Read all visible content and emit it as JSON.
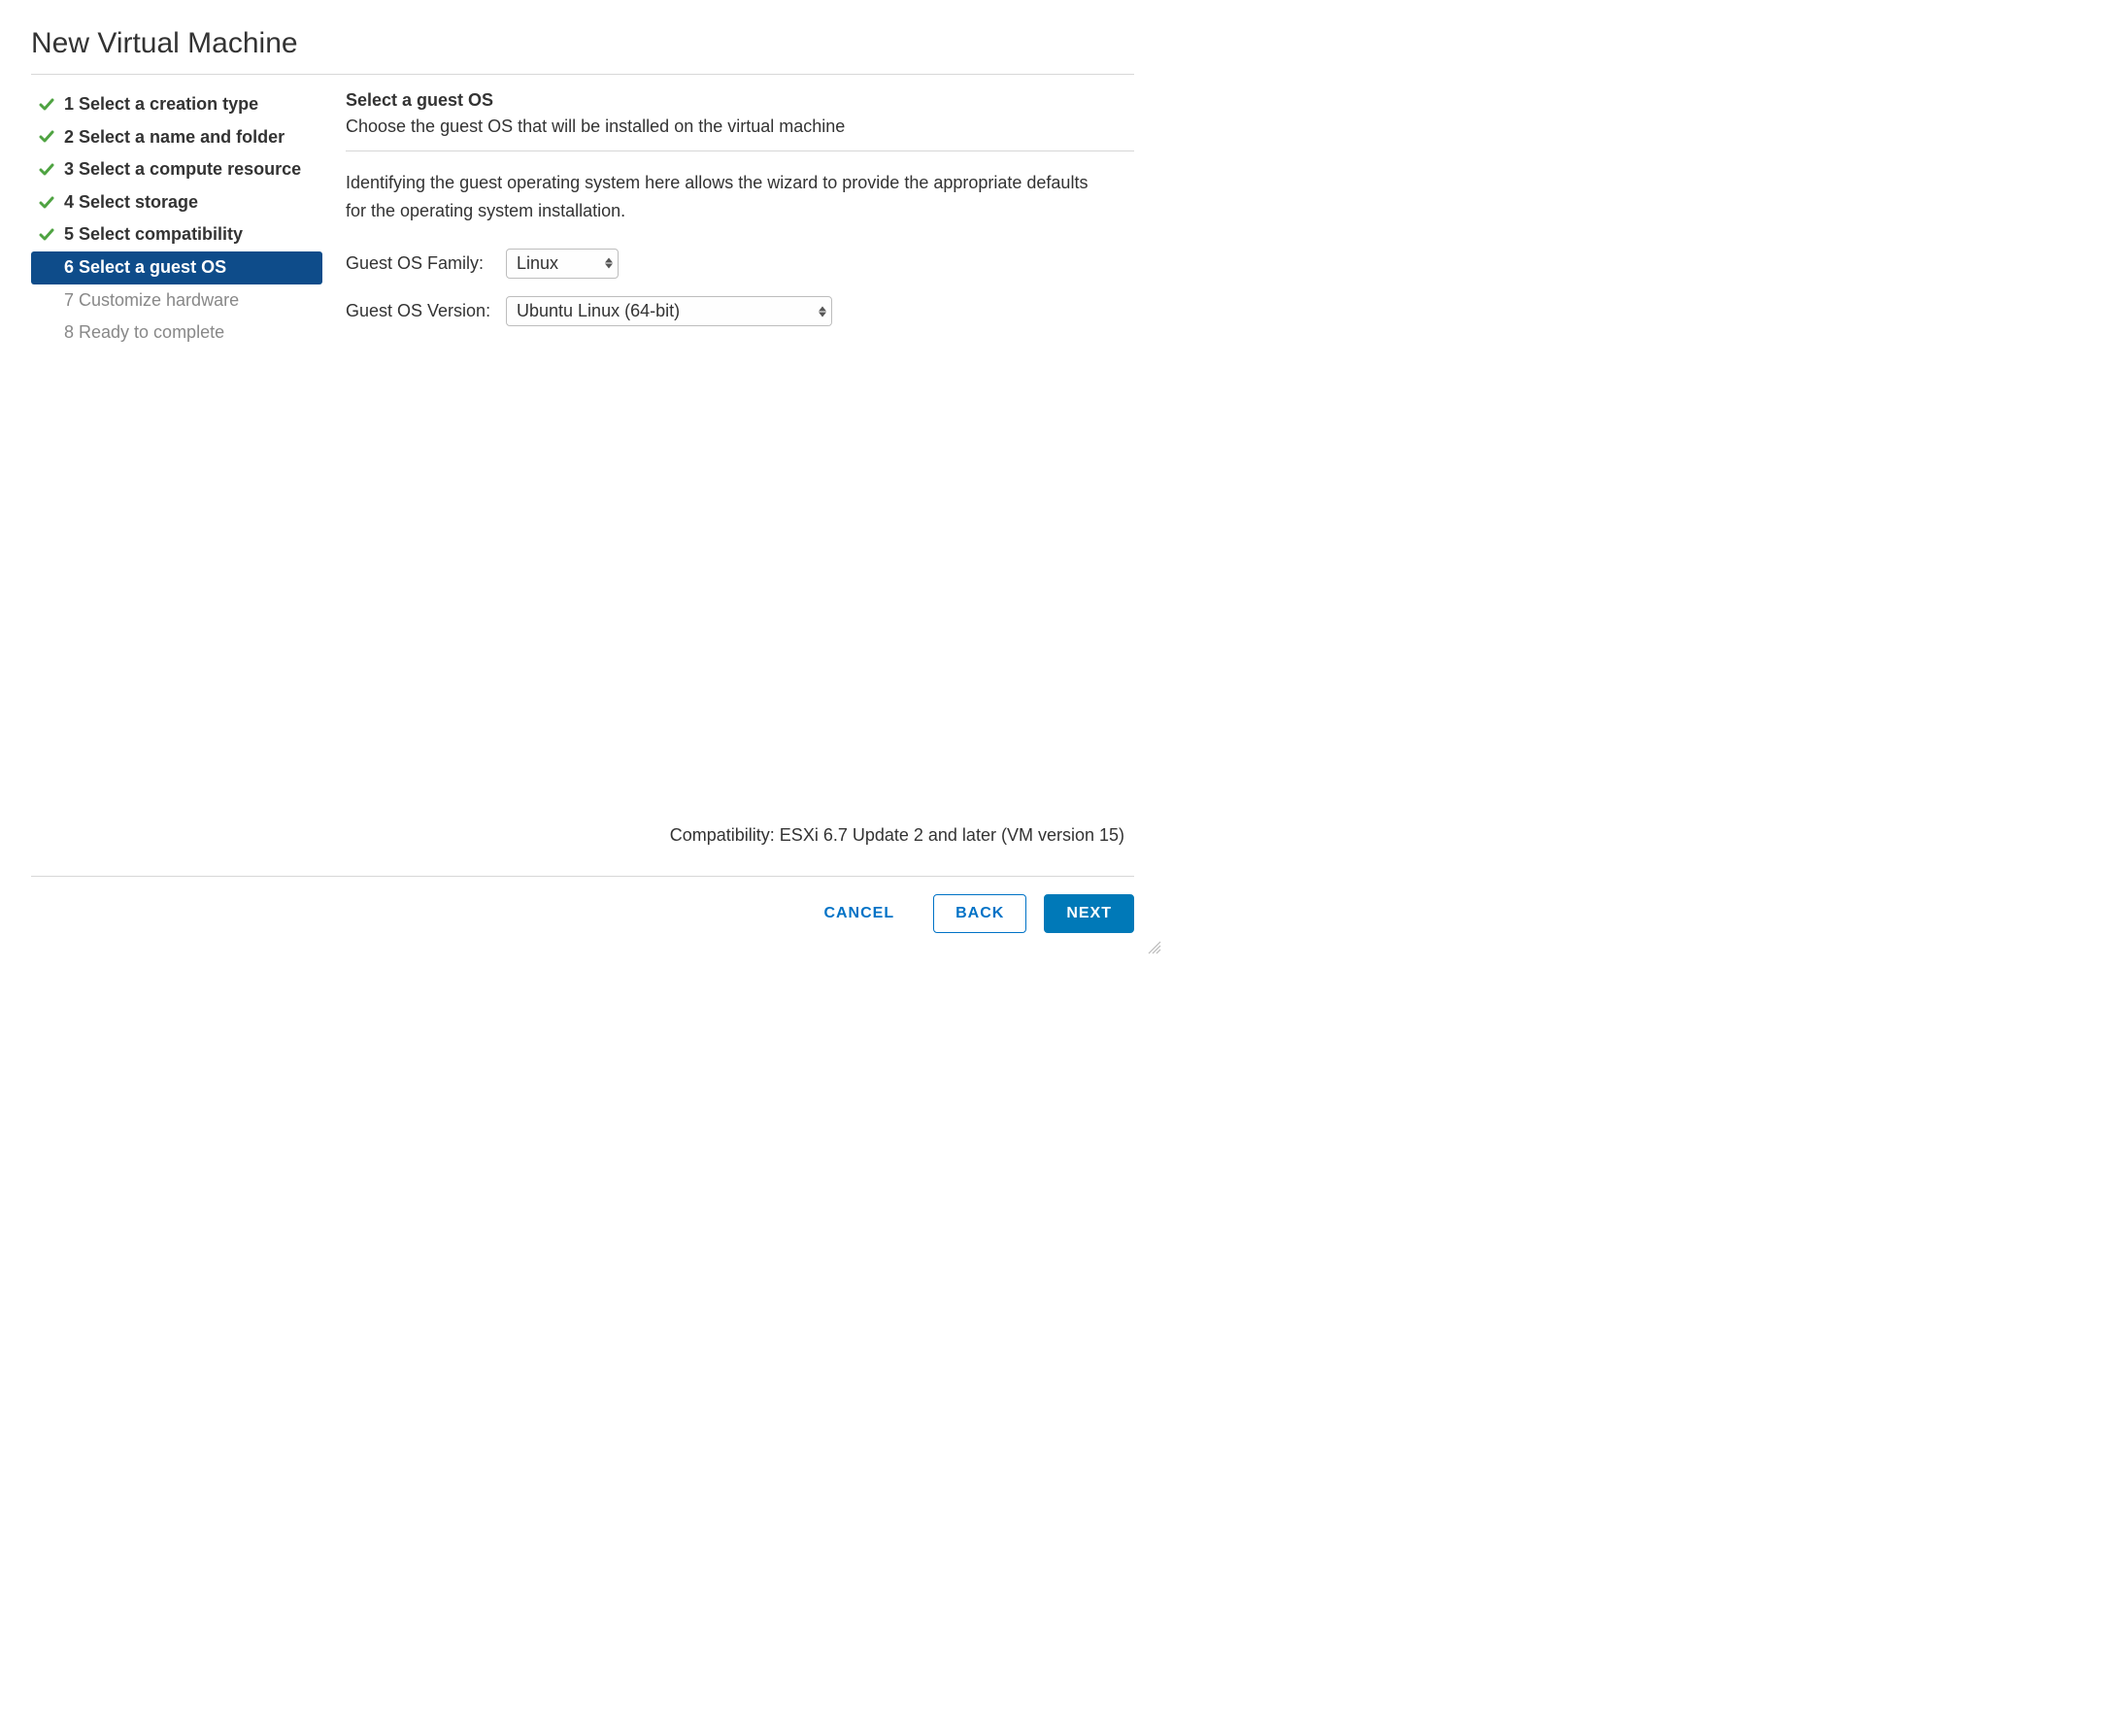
{
  "dialog": {
    "title": "New Virtual Machine"
  },
  "steps": [
    {
      "label": "1 Select a creation type",
      "state": "completed"
    },
    {
      "label": "2 Select a name and folder",
      "state": "completed"
    },
    {
      "label": "3 Select a compute resource",
      "state": "completed"
    },
    {
      "label": "4 Select storage",
      "state": "completed"
    },
    {
      "label": "5 Select compatibility",
      "state": "completed"
    },
    {
      "label": "6 Select a guest OS",
      "state": "active"
    },
    {
      "label": "7 Customize hardware",
      "state": "upcoming"
    },
    {
      "label": "8 Ready to complete",
      "state": "upcoming"
    }
  ],
  "panel": {
    "heading": "Select a guest OS",
    "subheading": "Choose the guest OS that will be installed on the virtual machine",
    "help_text": "Identifying the guest operating system here allows the wizard to provide the appropriate defaults for the operating system installation.",
    "family_label": "Guest OS Family:",
    "family_value": "Linux",
    "version_label": "Guest OS Version:",
    "version_value": "Ubuntu Linux (64-bit)"
  },
  "footer": {
    "compatibility": "Compatibility: ESXi 6.7 Update 2 and later (VM version 15)",
    "cancel": "Cancel",
    "back": "Back",
    "next": "Next"
  }
}
